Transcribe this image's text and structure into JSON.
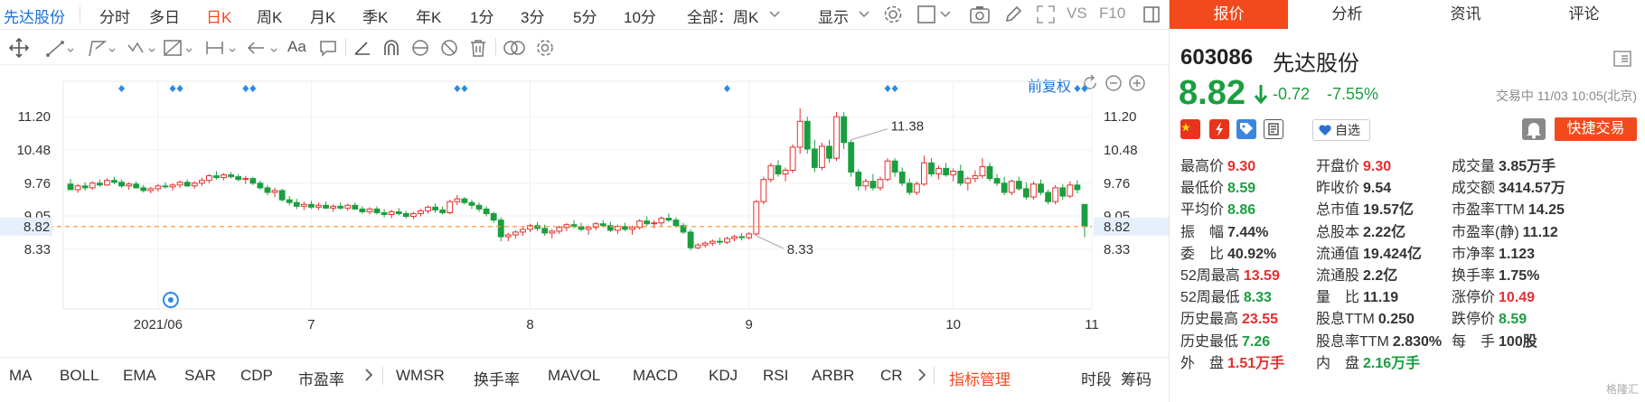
{
  "periodbar": {
    "stock_name": "先达股份",
    "periods": [
      "分时",
      "多日",
      "日K",
      "周K",
      "月K",
      "季K",
      "年K",
      "1分",
      "3分",
      "5分",
      "10分",
      "全部：周K"
    ],
    "active_period": "日K",
    "display_label": "显示",
    "vs_label": "VS",
    "f10_label": "F10"
  },
  "chart_header": {
    "fuquan_label": "前复权"
  },
  "chart_data": {
    "type": "candlestick",
    "y_ticks": [
      "11.20",
      "10.48",
      "9.76",
      "9.05",
      "8.33"
    ],
    "y_ticks_values": [
      11.2,
      10.48,
      9.76,
      9.05,
      8.33
    ],
    "current_price_label": "8.82",
    "current_price": 8.82,
    "ylim": [
      7.7,
      11.85
    ],
    "x_labels": [
      "2021/06",
      "7",
      "8",
      "9",
      "10",
      "11"
    ],
    "x_label_positions": [
      12,
      33,
      63,
      93,
      121,
      140
    ],
    "n_candles": 144,
    "max_label": "11.38",
    "max_index": 107,
    "min_label": "8.33",
    "min_index": 94,
    "event_marker_indices": [
      7,
      14,
      15,
      24,
      25,
      53,
      54,
      90,
      112,
      113,
      138,
      139,
      143,
      144
    ],
    "ohlc": [
      [
        9.74,
        9.85,
        9.61,
        9.62
      ],
      [
        9.62,
        9.74,
        9.55,
        9.7
      ],
      [
        9.7,
        9.78,
        9.6,
        9.66
      ],
      [
        9.66,
        9.8,
        9.62,
        9.76
      ],
      [
        9.76,
        9.84,
        9.68,
        9.72
      ],
      [
        9.72,
        9.86,
        9.7,
        9.82
      ],
      [
        9.82,
        9.9,
        9.74,
        9.78
      ],
      [
        9.78,
        9.84,
        9.66,
        9.7
      ],
      [
        9.7,
        9.78,
        9.62,
        9.74
      ],
      [
        9.74,
        9.8,
        9.64,
        9.66
      ],
      [
        9.66,
        9.72,
        9.56,
        9.6
      ],
      [
        9.6,
        9.68,
        9.54,
        9.64
      ],
      [
        9.64,
        9.74,
        9.58,
        9.7
      ],
      [
        9.7,
        9.78,
        9.64,
        9.68
      ],
      [
        9.68,
        9.76,
        9.6,
        9.72
      ],
      [
        9.72,
        9.82,
        9.66,
        9.78
      ],
      [
        9.78,
        9.84,
        9.68,
        9.7
      ],
      [
        9.7,
        9.8,
        9.64,
        9.76
      ],
      [
        9.76,
        9.88,
        9.7,
        9.82
      ],
      [
        9.82,
        9.96,
        9.76,
        9.92
      ],
      [
        9.92,
        10.02,
        9.84,
        9.88
      ],
      [
        9.88,
        9.98,
        9.82,
        9.94
      ],
      [
        9.94,
        10.0,
        9.86,
        9.9
      ],
      [
        9.9,
        9.96,
        9.8,
        9.84
      ],
      [
        9.84,
        9.92,
        9.74,
        9.86
      ],
      [
        9.86,
        9.9,
        9.72,
        9.76
      ],
      [
        9.76,
        9.82,
        9.62,
        9.66
      ],
      [
        9.66,
        9.72,
        9.5,
        9.56
      ],
      [
        9.56,
        9.66,
        9.46,
        9.6
      ],
      [
        9.6,
        9.64,
        9.36,
        9.4
      ],
      [
        9.4,
        9.48,
        9.28,
        9.34
      ],
      [
        9.34,
        9.42,
        9.2,
        9.26
      ],
      [
        9.26,
        9.36,
        9.18,
        9.3
      ],
      [
        9.3,
        9.38,
        9.2,
        9.24
      ],
      [
        9.24,
        9.34,
        9.18,
        9.28
      ],
      [
        9.28,
        9.36,
        9.2,
        9.22
      ],
      [
        9.22,
        9.3,
        9.14,
        9.26
      ],
      [
        9.26,
        9.34,
        9.18,
        9.22
      ],
      [
        9.22,
        9.32,
        9.16,
        9.28
      ],
      [
        9.28,
        9.34,
        9.18,
        9.2
      ],
      [
        9.2,
        9.26,
        9.1,
        9.14
      ],
      [
        9.14,
        9.24,
        9.08,
        9.2
      ],
      [
        9.2,
        9.26,
        9.08,
        9.12
      ],
      [
        9.12,
        9.2,
        9.02,
        9.08
      ],
      [
        9.08,
        9.18,
        9.0,
        9.14
      ],
      [
        9.14,
        9.22,
        9.06,
        9.1
      ],
      [
        9.1,
        9.16,
        9.0,
        9.04
      ],
      [
        9.04,
        9.14,
        8.98,
        9.1
      ],
      [
        9.1,
        9.2,
        9.04,
        9.16
      ],
      [
        9.16,
        9.28,
        9.1,
        9.24
      ],
      [
        9.24,
        9.32,
        9.12,
        9.18
      ],
      [
        9.18,
        9.26,
        9.08,
        9.12
      ],
      [
        9.12,
        9.4,
        9.08,
        9.36
      ],
      [
        9.36,
        9.5,
        9.28,
        9.42
      ],
      [
        9.42,
        9.46,
        9.3,
        9.34
      ],
      [
        9.34,
        9.4,
        9.2,
        9.28
      ],
      [
        9.28,
        9.34,
        9.14,
        9.2
      ],
      [
        9.2,
        9.26,
        9.04,
        9.1
      ],
      [
        9.1,
        9.14,
        8.9,
        8.96
      ],
      [
        8.96,
        9.02,
        8.5,
        8.6
      ],
      [
        8.6,
        8.68,
        8.5,
        8.64
      ],
      [
        8.64,
        8.74,
        8.56,
        8.7
      ],
      [
        8.7,
        8.8,
        8.62,
        8.76
      ],
      [
        8.76,
        8.88,
        8.7,
        8.84
      ],
      [
        8.84,
        8.92,
        8.72,
        8.78
      ],
      [
        8.78,
        8.86,
        8.62,
        8.68
      ],
      [
        8.68,
        8.76,
        8.56,
        8.72
      ],
      [
        8.72,
        8.84,
        8.66,
        8.8
      ],
      [
        8.8,
        8.9,
        8.72,
        8.86
      ],
      [
        8.86,
        8.96,
        8.78,
        8.82
      ],
      [
        8.82,
        8.9,
        8.72,
        8.76
      ],
      [
        8.76,
        8.84,
        8.64,
        8.8
      ],
      [
        8.8,
        8.92,
        8.74,
        8.88
      ],
      [
        8.88,
        8.96,
        8.8,
        8.84
      ],
      [
        8.84,
        8.92,
        8.7,
        8.74
      ],
      [
        8.74,
        8.86,
        8.66,
        8.82
      ],
      [
        8.82,
        8.9,
        8.72,
        8.76
      ],
      [
        8.76,
        8.84,
        8.64,
        8.8
      ],
      [
        8.8,
        8.98,
        8.76,
        8.94
      ],
      [
        8.94,
        9.04,
        8.84,
        8.88
      ],
      [
        8.88,
        8.96,
        8.78,
        8.9
      ],
      [
        8.9,
        9.04,
        8.84,
        9.0
      ],
      [
        9.0,
        9.1,
        8.92,
        8.96
      ],
      [
        8.96,
        9.02,
        8.8,
        8.84
      ],
      [
        8.84,
        8.9,
        8.66,
        8.7
      ],
      [
        8.7,
        8.76,
        8.3,
        8.36
      ],
      [
        8.36,
        8.46,
        8.33,
        8.42
      ],
      [
        8.42,
        8.5,
        8.36,
        8.46
      ],
      [
        8.46,
        8.54,
        8.4,
        8.5
      ],
      [
        8.5,
        8.58,
        8.42,
        8.48
      ],
      [
        8.48,
        8.6,
        8.44,
        8.56
      ],
      [
        8.56,
        8.64,
        8.5,
        8.6
      ],
      [
        8.6,
        8.68,
        8.52,
        8.58
      ],
      [
        8.58,
        8.7,
        8.54,
        8.66
      ],
      [
        8.66,
        9.4,
        8.62,
        9.36
      ],
      [
        9.36,
        9.9,
        9.3,
        9.84
      ],
      [
        9.84,
        10.2,
        9.78,
        10.14
      ],
      [
        10.14,
        10.26,
        9.9,
        9.96
      ],
      [
        9.96,
        10.1,
        9.8,
        10.04
      ],
      [
        10.04,
        10.6,
        9.98,
        10.54
      ],
      [
        10.54,
        11.38,
        10.4,
        11.1
      ],
      [
        11.1,
        11.2,
        10.4,
        10.5
      ],
      [
        10.5,
        10.7,
        10.0,
        10.1
      ],
      [
        10.1,
        10.64,
        10.04,
        10.56
      ],
      [
        10.56,
        10.7,
        10.2,
        10.3
      ],
      [
        10.3,
        11.3,
        10.24,
        11.2
      ],
      [
        11.2,
        11.3,
        10.5,
        10.64
      ],
      [
        10.64,
        10.7,
        9.9,
        10.0
      ],
      [
        10.0,
        10.06,
        9.6,
        9.7
      ],
      [
        9.7,
        9.86,
        9.6,
        9.8
      ],
      [
        9.8,
        9.96,
        9.6,
        9.66
      ],
      [
        9.66,
        9.9,
        9.6,
        9.84
      ],
      [
        9.84,
        10.3,
        9.8,
        10.24
      ],
      [
        10.24,
        10.3,
        9.9,
        10.0
      ],
      [
        10.0,
        10.1,
        9.7,
        9.76
      ],
      [
        9.76,
        9.86,
        9.5,
        9.56
      ],
      [
        9.56,
        9.8,
        9.5,
        9.74
      ],
      [
        9.74,
        10.36,
        9.7,
        10.2
      ],
      [
        10.2,
        10.3,
        9.9,
        9.96
      ],
      [
        9.96,
        10.14,
        9.84,
        10.08
      ],
      [
        10.08,
        10.2,
        9.9,
        9.94
      ],
      [
        9.94,
        10.08,
        9.8,
        10.02
      ],
      [
        10.02,
        10.16,
        9.7,
        9.76
      ],
      [
        9.76,
        9.9,
        9.6,
        9.86
      ],
      [
        9.86,
        10.04,
        9.78,
        9.92
      ],
      [
        9.92,
        10.3,
        9.86,
        10.12
      ],
      [
        10.12,
        10.2,
        9.8,
        9.86
      ],
      [
        9.86,
        9.96,
        9.7,
        9.76
      ],
      [
        9.76,
        9.9,
        9.5,
        9.56
      ],
      [
        9.56,
        9.84,
        9.5,
        9.8
      ],
      [
        9.8,
        9.9,
        9.6,
        9.64
      ],
      [
        9.64,
        9.78,
        9.4,
        9.46
      ],
      [
        9.46,
        9.8,
        9.4,
        9.74
      ],
      [
        9.74,
        9.84,
        9.5,
        9.56
      ],
      [
        9.56,
        9.62,
        9.3,
        9.36
      ],
      [
        9.36,
        9.72,
        9.3,
        9.66
      ],
      [
        9.66,
        9.74,
        9.4,
        9.48
      ],
      [
        9.48,
        9.8,
        9.44,
        9.72
      ],
      [
        9.72,
        9.82,
        9.54,
        9.62
      ],
      [
        9.3,
        9.3,
        8.59,
        8.82
      ]
    ]
  },
  "indicators": [
    "MA",
    "BOLL",
    "EMA",
    "SAR",
    "CDP",
    "市盈率",
    "WMSR",
    "换手率",
    "MAVOL",
    "MACD",
    "KDJ",
    "RSI",
    "ARBR",
    "CR"
  ],
  "indicator_manage": "指标管理",
  "indicator_right": [
    "时段",
    "筹码"
  ],
  "quote": {
    "tabs": [
      "报价",
      "分析",
      "资讯",
      "评论"
    ],
    "active_tab": "报价",
    "code": "603086",
    "name": "先达股份",
    "price": "8.82",
    "change": "-0.72",
    "change_pct": "-7.55%",
    "status": "交易中 11/03 10:05(北京)",
    "watch_label": "自选",
    "quick_trade": "快捷交易",
    "rows": [
      [
        [
          "最高价",
          "9.30",
          "up"
        ],
        [
          "开盘价",
          "9.30",
          "up"
        ],
        [
          "成交量",
          "3.85万手",
          "neutral"
        ]
      ],
      [
        [
          "最低价",
          "8.59",
          "down"
        ],
        [
          "昨收价",
          "9.54",
          "neutral"
        ],
        [
          "成交额",
          "3414.57万",
          "neutral"
        ]
      ],
      [
        [
          "平均价",
          "8.86",
          "down"
        ],
        [
          "总市值",
          "19.57亿",
          "neutral"
        ],
        [
          "市盈率TTM",
          "14.25",
          "neutral"
        ]
      ],
      [
        [
          "振　幅",
          "7.44%",
          "neutral"
        ],
        [
          "总股本",
          "2.22亿",
          "neutral"
        ],
        [
          "市盈率(静)",
          "11.12",
          "neutral"
        ]
      ],
      [
        [
          "委　比",
          "40.92%",
          "neutral"
        ],
        [
          "流通值",
          "19.424亿",
          "neutral"
        ],
        [
          "市净率",
          "1.123",
          "neutral"
        ]
      ],
      [
        [
          "52周最高",
          "13.59",
          "up"
        ],
        [
          "流通股",
          "2.2亿",
          "neutral"
        ],
        [
          "换手率",
          "1.75%",
          "neutral"
        ]
      ],
      [
        [
          "52周最低",
          "8.33",
          "down"
        ],
        [
          "量　比",
          "11.19",
          "neutral"
        ],
        [
          "涨停价",
          "10.49",
          "up"
        ]
      ],
      [
        [
          "历史最高",
          "23.55",
          "up"
        ],
        [
          "股息TTM",
          "0.250",
          "neutral"
        ],
        [
          "跌停价",
          "8.59",
          "down"
        ]
      ],
      [
        [
          "历史最低",
          "7.26",
          "down"
        ],
        [
          "股息率TTM",
          "2.830%",
          "neutral"
        ],
        [
          "每　手",
          "100股",
          "neutral"
        ]
      ],
      [
        [
          "外　盘",
          "1.51万手",
          "up"
        ],
        [
          "内　盘",
          "2.16万手",
          "down"
        ],
        [
          "",
          "",
          "neutral"
        ]
      ]
    ],
    "watermark": "格隆汇"
  },
  "colors": {
    "accent": "#f24a1d",
    "up": "#e62e2e",
    "down": "#1a9e3f",
    "link": "#1a70d8"
  }
}
